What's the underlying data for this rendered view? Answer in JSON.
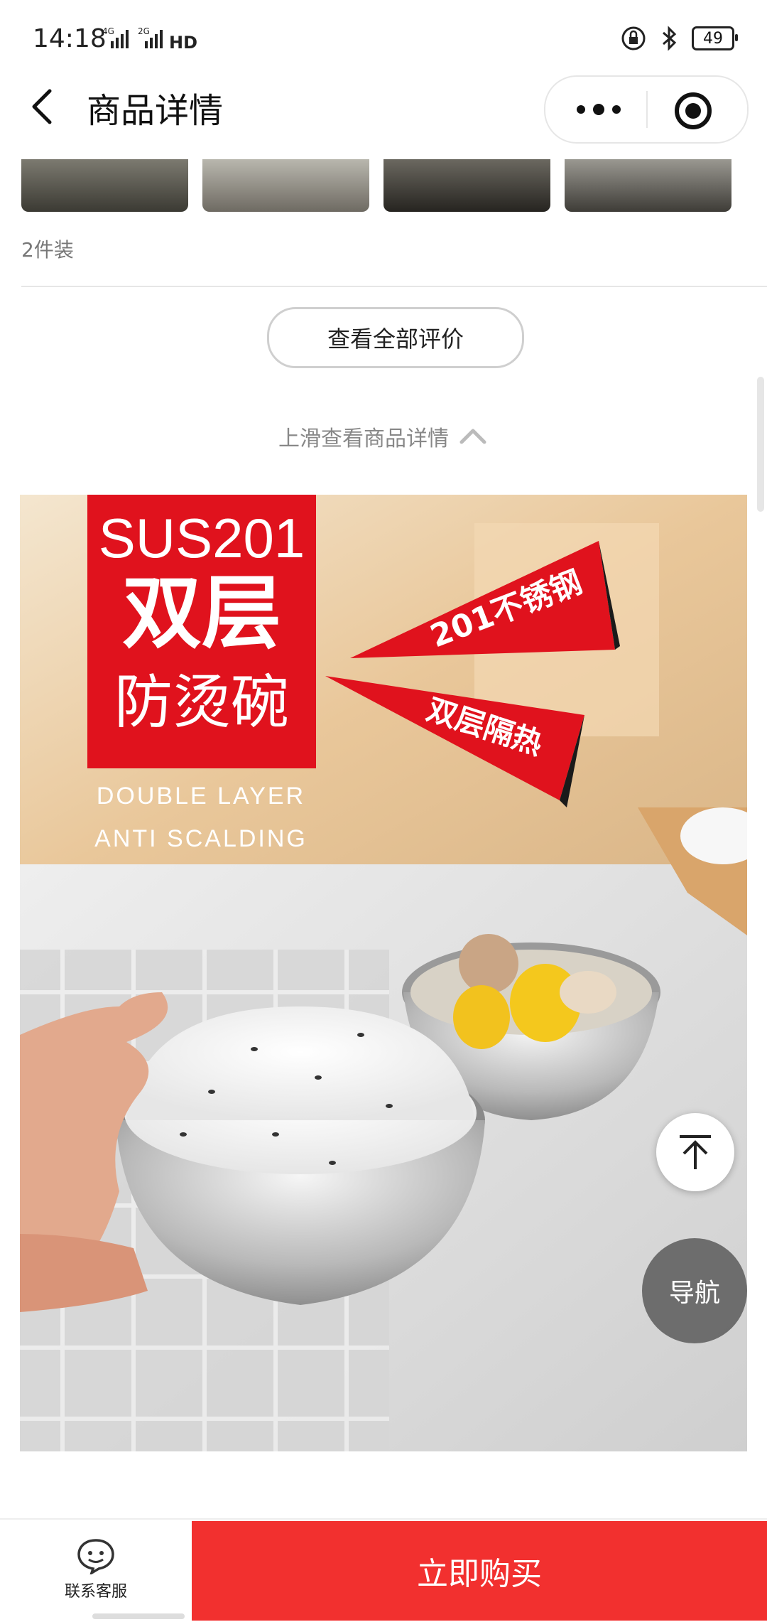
{
  "status_bar": {
    "time": "14:18",
    "network_1": "4G",
    "network_2": "2G",
    "hd_label": "HD",
    "battery": "49"
  },
  "header": {
    "title": "商品详情",
    "back_icon": "chevron-left-icon",
    "more_icon": "more-dots-icon",
    "close_icon": "target-icon"
  },
  "review": {
    "sku_text": "2件装",
    "view_all_label": "查看全部评价"
  },
  "scroll_hint": "上滑查看商品详情",
  "hero": {
    "headline_1": "SUS201",
    "headline_2": "双层",
    "headline_3": "防烫碗",
    "en_line_1": "DOUBLE LAYER",
    "en_line_2": "ANTI SCALDING",
    "flag_1": "201不锈钢",
    "flag_2": "双层隔热",
    "accent_color": "#e0121d"
  },
  "floating": {
    "to_top_icon": "arrow-up-to-top-icon",
    "nav_label": "导航"
  },
  "bottom_bar": {
    "customer_service_label": "联系客服",
    "buy_label": "立即购买",
    "buy_color": "#f2302f"
  }
}
